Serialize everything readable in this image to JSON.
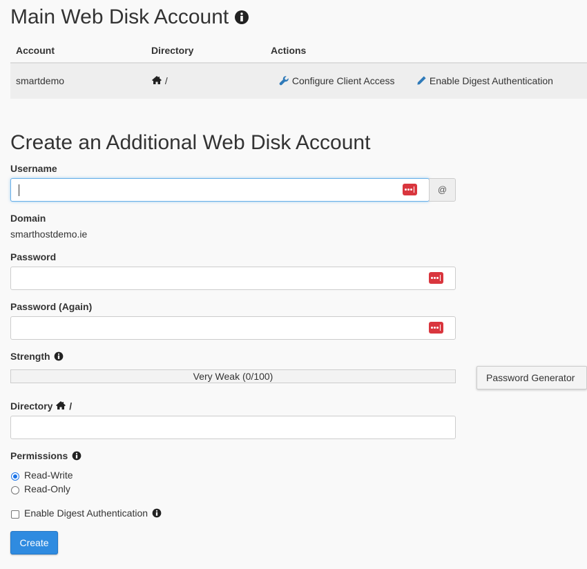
{
  "main_section": {
    "title": "Main Web Disk Account",
    "table": {
      "headers": [
        "Account",
        "Directory",
        "Actions"
      ],
      "row": {
        "account": "smartdemo",
        "directory": "/",
        "actions": [
          "Configure Client Access",
          "Enable Digest Authentication"
        ]
      }
    }
  },
  "create_section": {
    "title": "Create an Additional Web Disk Account",
    "username": {
      "label": "Username",
      "value": "",
      "at_symbol": "@"
    },
    "domain": {
      "label": "Domain",
      "value": "smarthostdemo.ie"
    },
    "password": {
      "label": "Password",
      "value": ""
    },
    "password_again": {
      "label": "Password (Again)",
      "value": ""
    },
    "strength": {
      "label": "Strength",
      "text": "Very Weak (0/100)",
      "score": 0
    },
    "password_generator_label": "Password Generator",
    "directory": {
      "label": "Directory",
      "suffix": "/",
      "value": ""
    },
    "permissions": {
      "label": "Permissions",
      "options": [
        "Read-Write",
        "Read-Only"
      ],
      "selected": "Read-Write"
    },
    "digest_auth": {
      "label": "Enable Digest Authentication",
      "checked": false
    },
    "create_label": "Create"
  },
  "colors": {
    "link": "#2f7ab9",
    "primary_button": "#2f8be0",
    "password_manager_icon": "#d9363e"
  },
  "icons": [
    "info-icon",
    "home-icon",
    "wrench-icon",
    "pencil-icon",
    "password-manager-icon"
  ]
}
